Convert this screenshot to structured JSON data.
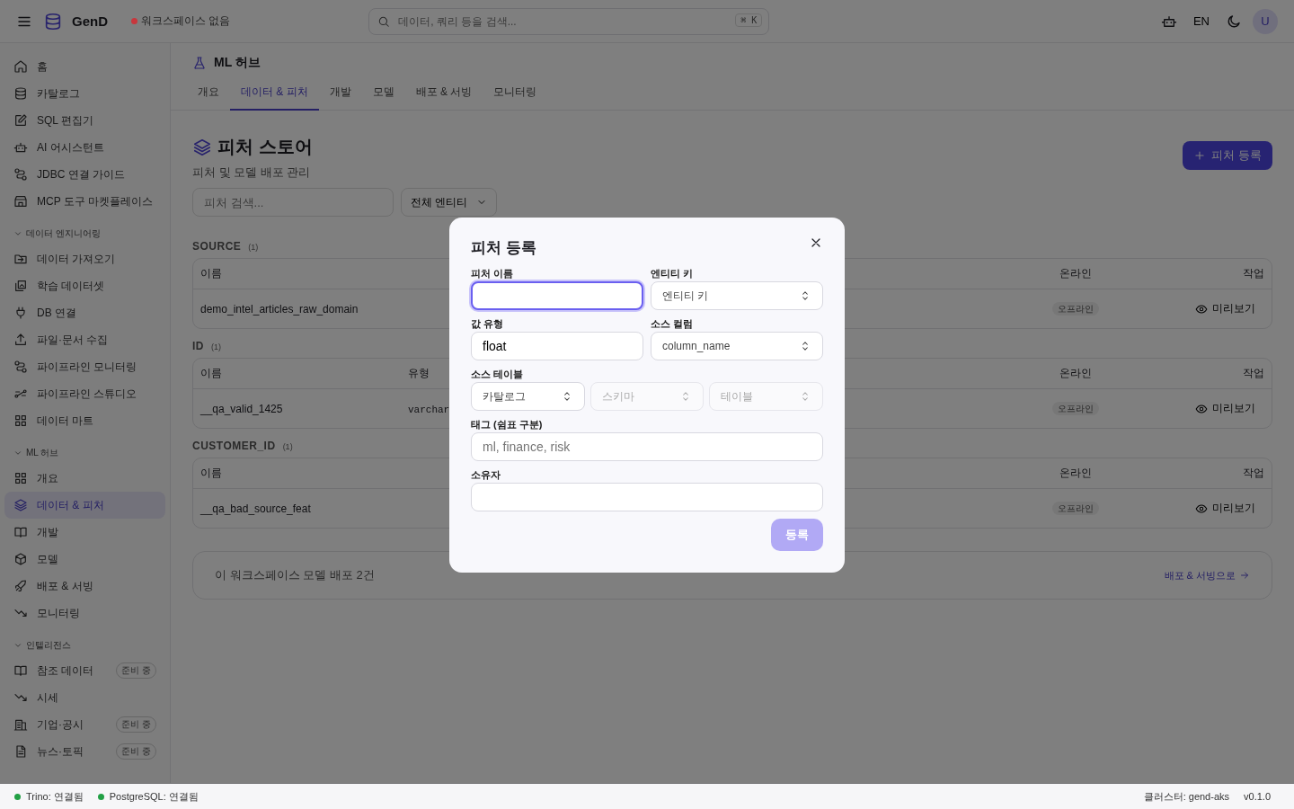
{
  "topbar": {
    "logo": "GenD",
    "workspace": {
      "label": "워크스페이스 없음",
      "color": "#c8373d"
    },
    "search": {
      "placeholder": "데이터, 쿼리 등을 검색...",
      "shortcut": "⌘ K"
    },
    "language": "EN",
    "avatar": "U"
  },
  "sidebar": {
    "items": [
      {
        "label": "홈",
        "selected": false
      },
      {
        "label": "카탈로그",
        "selected": false
      },
      {
        "label": "SQL 편집기",
        "selected": false
      },
      {
        "label": "AI 어시스턴트",
        "selected": false
      },
      {
        "label": "JDBC 연결 가이드",
        "selected": false
      },
      {
        "label": "MCP 도구 마켓플레이스",
        "selected": false
      }
    ],
    "groups": [
      {
        "title": "데이터 엔지니어링",
        "expanded": true,
        "items": [
          {
            "label": "데이터 가져오기",
            "selected": false
          },
          {
            "label": "학습 데이터셋",
            "selected": false
          },
          {
            "label": "DB 연결",
            "selected": false
          },
          {
            "label": "파일·문서 수집",
            "selected": false
          },
          {
            "label": "파이프라인 모니터링",
            "selected": false
          },
          {
            "label": "파이프라인 스튜디오",
            "selected": false
          },
          {
            "label": "데이터 마트",
            "selected": false
          }
        ]
      },
      {
        "title": "ML 허브",
        "expanded": true,
        "items": [
          {
            "label": "개요",
            "selected": false
          },
          {
            "label": "데이터 & 피처",
            "selected": true
          },
          {
            "label": "개발",
            "selected": false
          },
          {
            "label": "모델",
            "selected": false
          },
          {
            "label": "배포 & 서빙",
            "selected": false
          },
          {
            "label": "모니터링",
            "selected": false
          }
        ]
      },
      {
        "title": "인텔리전스",
        "expanded": true,
        "items": [
          {
            "label": "참조 데이터",
            "selected": false,
            "badge": "준비 중"
          },
          {
            "label": "시세",
            "selected": false
          },
          {
            "label": "기업·공시",
            "selected": false,
            "badge": "준비 중"
          },
          {
            "label": "뉴스·토픽",
            "selected": false,
            "badge": "준비 중"
          }
        ]
      }
    ]
  },
  "page": {
    "section": "ML 허브",
    "tabs": [
      {
        "label": "개요",
        "selected": false
      },
      {
        "label": "데이터 & 피처",
        "selected": true
      },
      {
        "label": "개발",
        "selected": false
      },
      {
        "label": "모델",
        "selected": false
      },
      {
        "label": "배포 & 서빙",
        "selected": false
      },
      {
        "label": "모니터링",
        "selected": false
      }
    ],
    "title": "피처 스토어",
    "subtitle": "피처 및 모델 배포 관리",
    "create_button": "피처 등록",
    "filters": {
      "search_placeholder": "피처 검색...",
      "selects": [
        "전체 엔티티"
      ]
    },
    "groups": [
      {
        "name": "SOURCE",
        "count": "(1)",
        "columns": [
          {
            "kind": "name",
            "label": "이름"
          },
          {
            "kind": "online",
            "label": "온라인"
          },
          {
            "kind": "actions",
            "label": "작업"
          }
        ],
        "rows": [
          {
            "name": "demo_intel_articles_raw_domain",
            "online": "오프라인",
            "action": "미리보기"
          }
        ]
      },
      {
        "name": "ID",
        "count": "(1)",
        "columns": [
          {
            "kind": "name",
            "label": "이름"
          },
          {
            "kind": "type",
            "label": "유형"
          },
          {
            "kind": "online",
            "label": "온라인"
          },
          {
            "kind": "actions",
            "label": "작업"
          }
        ],
        "rows": [
          {
            "name": "__qa_valid_1425",
            "type": "varchar",
            "online": "오프라인",
            "action": "미리보기"
          }
        ]
      },
      {
        "name": "CUSTOMER_ID",
        "count": "(1)",
        "columns": [
          {
            "kind": "name",
            "label": "이름"
          },
          {
            "kind": "online",
            "label": "온라인"
          },
          {
            "kind": "actions",
            "label": "작업"
          }
        ],
        "rows": [
          {
            "name": "__qa_bad_source_feat",
            "online": "오프라인",
            "action": "미리보기"
          }
        ]
      }
    ],
    "deployment_card": {
      "text": "이 워크스페이스 모델 배포 2건",
      "link": "배포 & 서빙으로"
    }
  },
  "dialog": {
    "title": "피처 등록",
    "rows": [
      [
        {
          "kind": "input",
          "label": "피처 이름",
          "focused": true
        },
        {
          "kind": "select",
          "label": "엔티티 키",
          "placeholder": "엔티티 키"
        }
      ],
      [
        {
          "kind": "input",
          "label": "값 유형",
          "value": "float"
        },
        {
          "kind": "select",
          "label": "소스 컬럼",
          "placeholder": "column_name"
        }
      ],
      [
        {
          "kind": "select-group",
          "label": "소스 테이블",
          "options": [
            {
              "placeholder": "카탈로그",
              "disabled": false
            },
            {
              "placeholder": "스키마",
              "disabled": true
            },
            {
              "placeholder": "테이블",
              "disabled": true
            }
          ]
        }
      ],
      [
        {
          "kind": "input",
          "label": "태그 (쉼표 구분)",
          "placeholder": "ml, finance, risk"
        }
      ],
      [
        {
          "kind": "input",
          "label": "소유자"
        }
      ]
    ],
    "submit": {
      "label": "등록",
      "disabled": true
    }
  },
  "status_bar": {
    "connections": [
      {
        "label": "Trino: 연결됨",
        "color": "#22a045"
      },
      {
        "label": "PostgreSQL: 연결됨",
        "color": "#22a045"
      }
    ],
    "cluster": "클러스터: gend-aks",
    "version": "v0.1.0"
  }
}
